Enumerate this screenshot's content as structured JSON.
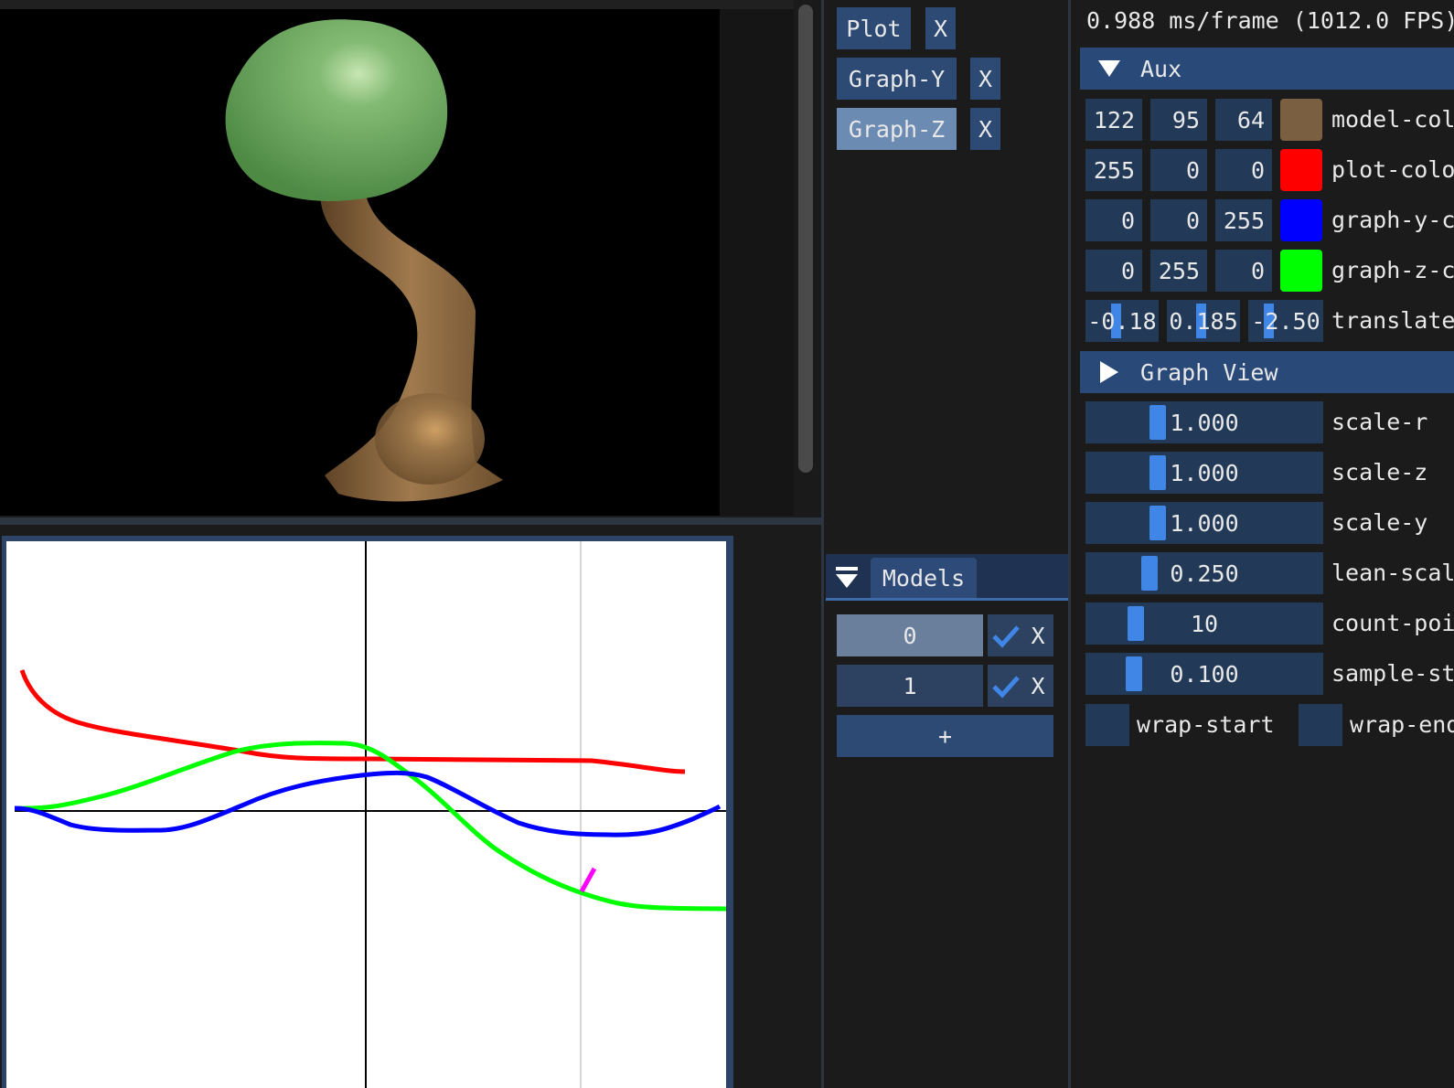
{
  "performance": {
    "text": "0.988 ms/frame (1012.0 FPS)"
  },
  "plot_tabs": [
    {
      "label": "Plot",
      "close": "X"
    },
    {
      "label": "Graph-Y",
      "close": "X"
    },
    {
      "label": "Graph-Z",
      "close": "X"
    }
  ],
  "models": {
    "title": "Models",
    "items": [
      {
        "label": "0",
        "close": "X"
      },
      {
        "label": "1",
        "close": "X"
      }
    ],
    "add_label": "+"
  },
  "aux": {
    "title": "Aux",
    "colors": [
      {
        "r": "122",
        "g": "95",
        "b": "64",
        "swatch": "#7a5f40",
        "label": "model-color"
      },
      {
        "r": "255",
        "g": "0",
        "b": "0",
        "swatch": "#ff0000",
        "label": "plot-color"
      },
      {
        "r": "0",
        "g": "0",
        "b": "255",
        "swatch": "#0000ff",
        "label": "graph-y-color"
      },
      {
        "r": "0",
        "g": "255",
        "b": "0",
        "swatch": "#00ff00",
        "label": "graph-z-color"
      }
    ],
    "translate": {
      "x": "-0.18",
      "y": "0.185",
      "z": "-2.50",
      "label": "translate"
    }
  },
  "graph_view": {
    "title": "Graph View",
    "sliders": [
      {
        "value": "1.000",
        "level": 0.29,
        "label": "scale-r"
      },
      {
        "value": "1.000",
        "level": 0.29,
        "label": "scale-z"
      },
      {
        "value": "1.000",
        "level": 0.29,
        "label": "scale-y"
      },
      {
        "value": "0.250",
        "level": 0.25,
        "label": "lean-scale"
      },
      {
        "value": "10",
        "level": 0.19,
        "label": "count-points"
      },
      {
        "value": "0.100",
        "level": 0.18,
        "label": "sample-step"
      }
    ],
    "wrap_start": "wrap-start",
    "wrap_end": "wrap-end"
  },
  "colors": {
    "accent": "#3f86e6",
    "header": "#294a78",
    "frame": "#223a57",
    "curve_red": "#ff0000",
    "curve_green": "#00ff00",
    "curve_blue": "#0000ff",
    "marker": "#ff00ff"
  }
}
